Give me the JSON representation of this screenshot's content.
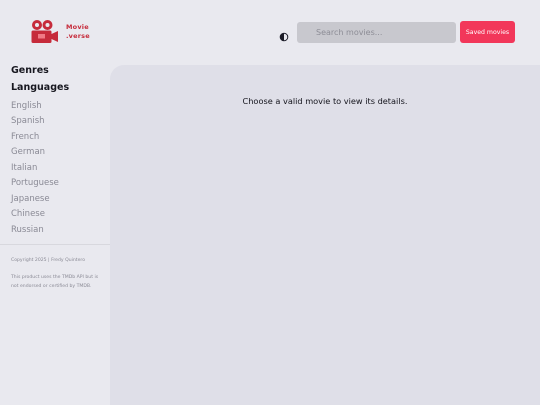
{
  "logo": {
    "line1": "Movie",
    "line2": ".verse",
    "icon": "movie-camera-icon",
    "color": "#c62b3b"
  },
  "header": {
    "theme_toggle_icon": "half-moon-icon",
    "search_placeholder": "Search movies...",
    "saved_button": "Saved movies",
    "accent": "#f2375a"
  },
  "sidebar": {
    "genres_label": "Genres",
    "languages_label": "Languages",
    "languages": [
      "English",
      "Spanish",
      "French",
      "German",
      "Italian",
      "Portuguese",
      "Japanese",
      "Chinese",
      "Russian"
    ],
    "copyright": "Copyright 2025 | Fredy Quintero",
    "disclaimer": "This product uses the TMDb API but is not endorsed or certified by TMDB."
  },
  "main": {
    "empty_message": "Choose a valid movie to view its details."
  }
}
